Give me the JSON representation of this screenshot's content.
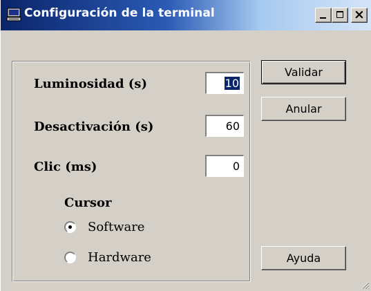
{
  "window": {
    "title": "Configuración de la terminal",
    "icon": "terminal-icon",
    "title_colors": {
      "start": "#0a246a",
      "end": "#a6caf0"
    }
  },
  "titlebar_buttons": {
    "minimize": "minimize-icon",
    "maximize": "maximize-icon",
    "close": "close-icon"
  },
  "fields": [
    {
      "label": "Luminosidad (s)",
      "value": "10",
      "selected": true
    },
    {
      "label": "Desactivación (s)",
      "value": "60"
    },
    {
      "label": "Clic (ms)",
      "value": "0"
    }
  ],
  "cursor": {
    "heading": "Cursor",
    "options": [
      {
        "label": "Software",
        "checked": true
      },
      {
        "label": "Hardware",
        "checked": false
      }
    ]
  },
  "buttons": {
    "validate": "Validar",
    "cancel": "Anular",
    "help": "Ayuda"
  },
  "colors": {
    "face": "#d4d0c8",
    "selection": "#0a246a"
  }
}
